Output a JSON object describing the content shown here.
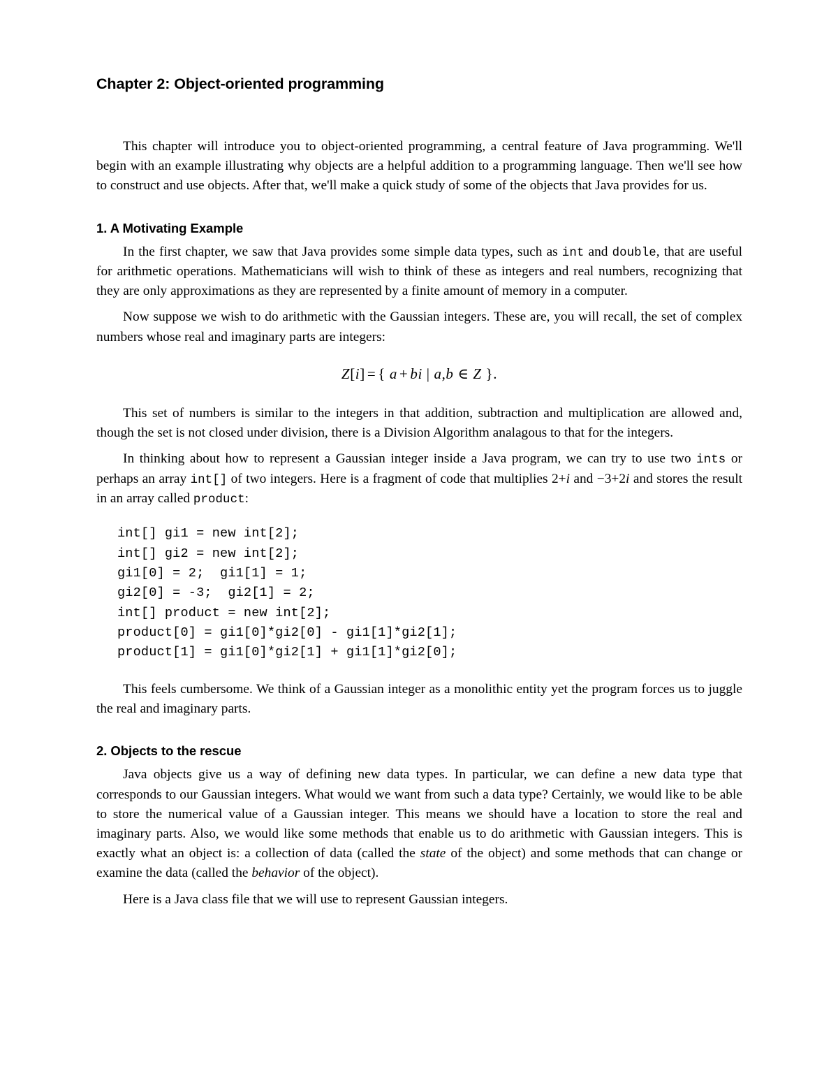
{
  "document": {
    "chapter_title": "Chapter 2: Object-oriented programming",
    "intro_paragraph": "This chapter will introduce you to object-oriented programming, a central feature of Java programming. We'll begin with an example illustrating why objects are a helpful addition to a programming language. Then we'll see how to construct and use objects. After that, we'll make a quick study of some of the objects that Java provides for us."
  },
  "section1": {
    "heading": "1. A Motivating Example",
    "p1_part1": "In the first chapter, we saw that Java provides some simple data types, such as ",
    "p1_code1": "int",
    "p1_part2": " and ",
    "p1_code2": "double",
    "p1_part3": ", that are useful for arithmetic operations. Mathematicians will wish to think of these as integers and real numbers, recognizing that they are only approximations as they are represented by a finite amount of memory in a computer.",
    "p2": "Now suppose we wish to do arithmetic with the Gaussian integers. These are, you will recall, the set of complex numbers whose real and imaginary parts are integers:",
    "equation": {
      "lhs_var": "Z",
      "lhs_bracket_open": "[",
      "lhs_index": "i",
      "lhs_bracket_close": "]",
      "equals": "=",
      "brace_open": "{",
      "term_a": "a",
      "plus": "+",
      "term_b": "b",
      "term_i": "i",
      "divider": "|",
      "set_a": "a",
      "comma": ",",
      "set_b": "b",
      "member": "∈",
      "set_z": "Z",
      "brace_close": "}",
      "period": ".",
      "plain": "Z[i] = { a + bi | a, b ∈ Z }."
    },
    "p3": "This set of numbers is similar to the integers in that addition, subtraction and multiplication are allowed and, though the set is not closed under division, there is a Division Algorithm analagous to that for the integers.",
    "p4_part1": "In thinking about how to represent a Gaussian integer inside a Java program, we can try to use two ",
    "p4_code1": "ints",
    "p4_part2": " or perhaps an array ",
    "p4_code2": "int[]",
    "p4_part3": " of two integers. Here is a fragment of code that multiplies ",
    "p4_math1_num": "2",
    "p4_math1_op": "+",
    "p4_math1_i": "i",
    "p4_part4": " and ",
    "p4_math2_neg": "−3",
    "p4_math2_op": "+",
    "p4_math2_num": "2",
    "p4_math2_i": "i",
    "p4_part5": " and stores the result in an array called ",
    "p4_code3": "product",
    "p4_part6": ":",
    "code_lines": [
      "int[] gi1 = new int[2];",
      "int[] gi2 = new int[2];",
      "gi1[0] = 2;  gi1[1] = 1;",
      "gi2[0] = -3;  gi2[1] = 2;",
      "int[] product = new int[2];",
      "product[0] = gi1[0]*gi2[0] - gi1[1]*gi2[1];",
      "product[1] = gi1[0]*gi2[1] + gi1[1]*gi2[0];"
    ],
    "code_block_text": "int[] gi1 = new int[2];\nint[] gi2 = new int[2];\ngi1[0] = 2;  gi1[1] = 1;\ngi2[0] = -3;  gi2[1] = 2;\nint[] product = new int[2];\nproduct[0] = gi1[0]*gi2[0] - gi1[1]*gi2[1];\nproduct[1] = gi1[0]*gi2[1] + gi1[1]*gi2[0];",
    "p5": "This feels cumbersome. We think of a Gaussian integer as a monolithic entity yet the program forces us to juggle the real and imaginary parts."
  },
  "section2": {
    "heading": "2. Objects to the rescue",
    "p1_part1": "Java objects give us a way of defining new data types. In particular, we can define a new data type that corresponds to our Gaussian integers. What would we want from such a data type? Certainly, we would like to be able to store the numerical value of a Gaussian integer. This means we should have a location to store the real and imaginary parts. Also, we would like some methods that enable us to do arithmetic with Gaussian integers. This is exactly what an object is: a collection of data (called the ",
    "p1_em1": "state",
    "p1_part2": " of the object) and some methods that can change or examine the data (called the ",
    "p1_em2": "behavior",
    "p1_part3": " of the object).",
    "p2": "Here is a Java class file that we will use to represent Gaussian integers."
  }
}
